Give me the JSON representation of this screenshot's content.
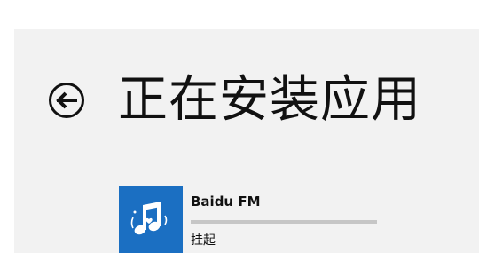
{
  "page": {
    "title": "正在安装应用",
    "back_icon": "back-arrow-circle-icon"
  },
  "colors": {
    "panel_background": "#f2f2f2",
    "tile_background": "#1b6fc2",
    "progress_track": "#c6c6c6",
    "text": "#111111"
  },
  "install_item": {
    "app_name": "Baidu FM",
    "status": "挂起",
    "icon": "music-note-icon",
    "progress_fraction": 0
  }
}
